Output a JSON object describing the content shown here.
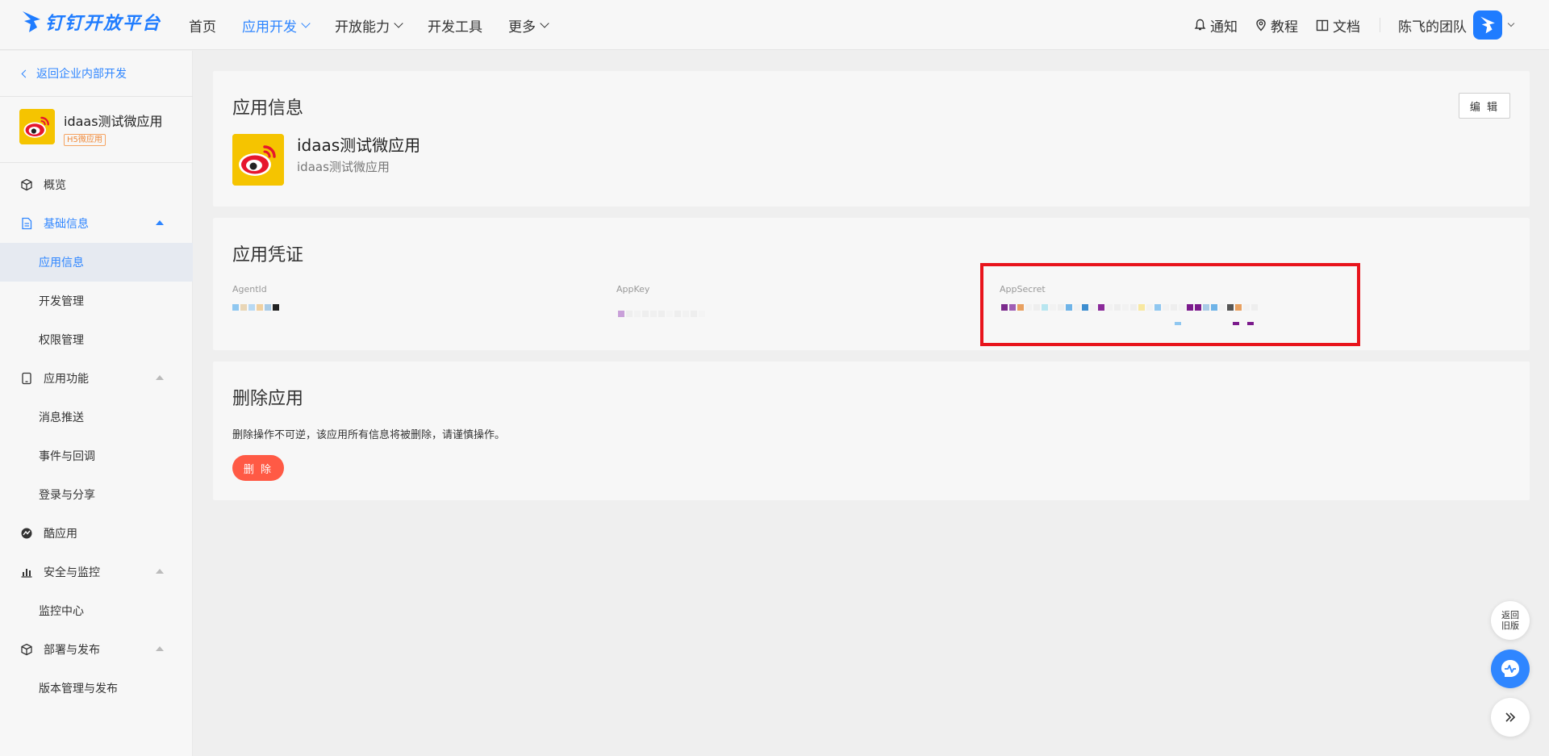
{
  "brand": {
    "logo_text": "钉钉开放平台",
    "color": "#1f7cff"
  },
  "nav": {
    "items": [
      {
        "label": "首页",
        "has_menu": false,
        "active": false
      },
      {
        "label": "应用开发",
        "has_menu": true,
        "active": true
      },
      {
        "label": "开放能力",
        "has_menu": true,
        "active": false
      },
      {
        "label": "开发工具",
        "has_menu": false,
        "active": false
      },
      {
        "label": "更多",
        "has_menu": true,
        "active": false
      }
    ]
  },
  "topright": {
    "notify": "通知",
    "tutorial": "教程",
    "docs": "文档",
    "team": "陈飞的团队"
  },
  "sidebar": {
    "back": "返回企业内部开发",
    "app_name": "idaas测试微应用",
    "app_tag": "H5微应用",
    "menu": [
      {
        "label": "概览",
        "type": "group",
        "icon": "cube-icon"
      },
      {
        "label": "基础信息",
        "type": "group",
        "icon": "document-icon",
        "expanded": true,
        "active": true
      },
      {
        "label": "应用信息",
        "type": "sub",
        "active": true
      },
      {
        "label": "开发管理",
        "type": "sub"
      },
      {
        "label": "权限管理",
        "type": "sub"
      },
      {
        "label": "应用功能",
        "type": "group",
        "icon": "phone-icon",
        "expanded": true
      },
      {
        "label": "消息推送",
        "type": "sub"
      },
      {
        "label": "事件与回调",
        "type": "sub"
      },
      {
        "label": "登录与分享",
        "type": "sub"
      },
      {
        "label": "酷应用",
        "type": "group",
        "icon": "cool-app-icon"
      },
      {
        "label": "安全与监控",
        "type": "group",
        "icon": "bar-chart-icon",
        "expanded": true
      },
      {
        "label": "监控中心",
        "type": "sub"
      },
      {
        "label": "部署与发布",
        "type": "group",
        "icon": "cube-icon",
        "expanded": true
      },
      {
        "label": "版本管理与发布",
        "type": "sub"
      }
    ]
  },
  "app_info": {
    "title": "应用信息",
    "edit": "编 辑",
    "name": "idaas测试微应用",
    "desc": "idaas测试微应用"
  },
  "credentials": {
    "title": "应用凭证",
    "agent_id_label": "AgentId",
    "app_key_label": "AppKey",
    "app_secret_label": "AppSecret"
  },
  "delete": {
    "title": "删除应用",
    "warning": "删除操作不可逆，该应用所有信息将被删除，请谨慎操作。",
    "button": "删 除"
  },
  "floating": {
    "old_version": "返回旧版"
  },
  "colors": {
    "accent": "#2f86ff",
    "danger": "#ff5a45",
    "highlight": "#e8141c"
  }
}
